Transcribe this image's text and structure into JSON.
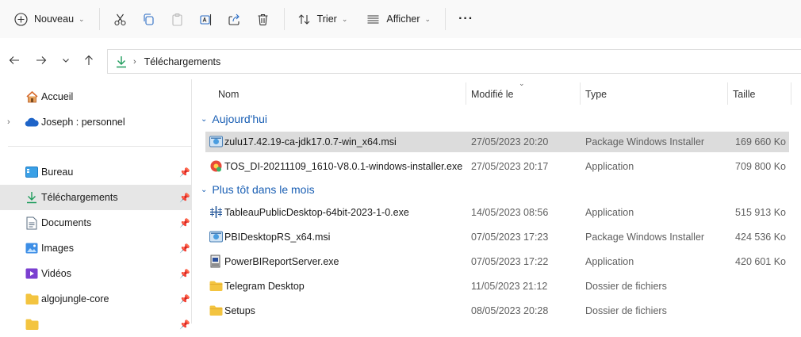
{
  "toolbar": {
    "new_label": "Nouveau",
    "sort_label": "Trier",
    "view_label": "Afficher",
    "more_label": "···"
  },
  "address": {
    "current_folder": "Téléchargements"
  },
  "sidebar": {
    "items": [
      {
        "label": "Accueil"
      },
      {
        "label": "Joseph : personnel"
      },
      {
        "label": "Bureau"
      },
      {
        "label": "Téléchargements"
      },
      {
        "label": "Documents"
      },
      {
        "label": "Images"
      },
      {
        "label": "Vidéos"
      },
      {
        "label": "algojungle-core"
      }
    ]
  },
  "columns": {
    "name": "Nom",
    "modified": "Modifié le",
    "type": "Type",
    "size": "Taille"
  },
  "groups": [
    {
      "label": "Aujourd'hui"
    },
    {
      "label": "Plus tôt dans le mois"
    }
  ],
  "files": [
    {
      "name": "zulu17.42.19-ca-jdk17.0.7-win_x64.msi",
      "date": "27/05/2023 20:20",
      "type": "Package Windows Installer",
      "size": "169 660 Ko"
    },
    {
      "name": "TOS_DI-20211109_1610-V8.0.1-windows-installer.exe",
      "date": "27/05/2023 20:17",
      "type": "Application",
      "size": "709 800 Ko"
    },
    {
      "name": "TableauPublicDesktop-64bit-2023-1-0.exe",
      "date": "14/05/2023 08:56",
      "type": "Application",
      "size": "515 913 Ko"
    },
    {
      "name": "PBIDesktopRS_x64.msi",
      "date": "07/05/2023 17:23",
      "type": "Package Windows Installer",
      "size": "424 536 Ko"
    },
    {
      "name": "PowerBIReportServer.exe",
      "date": "07/05/2023 17:22",
      "type": "Application",
      "size": "420 601 Ko"
    },
    {
      "name": "Telegram Desktop",
      "date": "11/05/2023 21:12",
      "type": "Dossier de fichiers",
      "size": ""
    },
    {
      "name": "Setups",
      "date": "08/05/2023 20:28",
      "type": "Dossier de fichiers",
      "size": ""
    }
  ],
  "colors": {
    "accent": "#1a5fb4",
    "selection": "#dcdcdc",
    "folder": "#f3c440"
  }
}
